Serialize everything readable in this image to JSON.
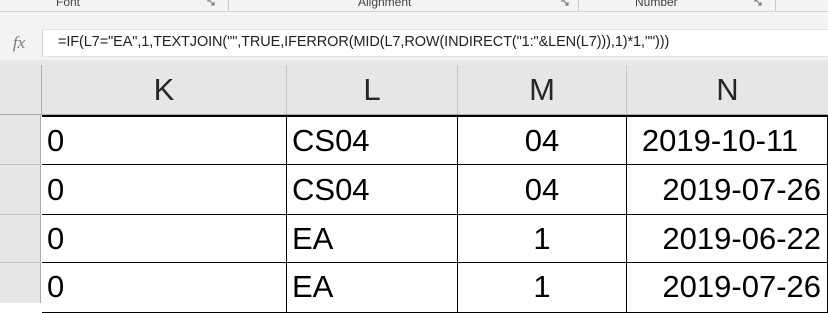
{
  "ribbon": {
    "groups": [
      {
        "label": "Font"
      },
      {
        "label": "Alignment"
      },
      {
        "label": "Number"
      }
    ]
  },
  "formula_bar": {
    "fx_label": "fx",
    "formula": "=IF(L7=\"EA\",1,TEXTJOIN(\"\",TRUE,IFERROR(MID(L7,ROW(INDIRECT(\"1:\"&LEN(L7))),1)*1,\"\")))"
  },
  "columns": [
    "K",
    "L",
    "M",
    "N"
  ],
  "rows": [
    {
      "K": "0",
      "L": "CS04",
      "M": "04",
      "N": "2019-10-11"
    },
    {
      "K": "0",
      "L": "CS04",
      "M": "04",
      "N": "2019-07-26"
    },
    {
      "K": "0",
      "L": "EA",
      "M": "1",
      "N": "2019-06-22"
    },
    {
      "K": "0",
      "L": "EA",
      "M": "1",
      "N": "2019-07-26"
    }
  ],
  "colors": {
    "ribbon_bg": "#f3f3f3",
    "header_bg": "#e6e6e6",
    "gridline": "#c6c6c6",
    "cell_border": "#000000"
  }
}
